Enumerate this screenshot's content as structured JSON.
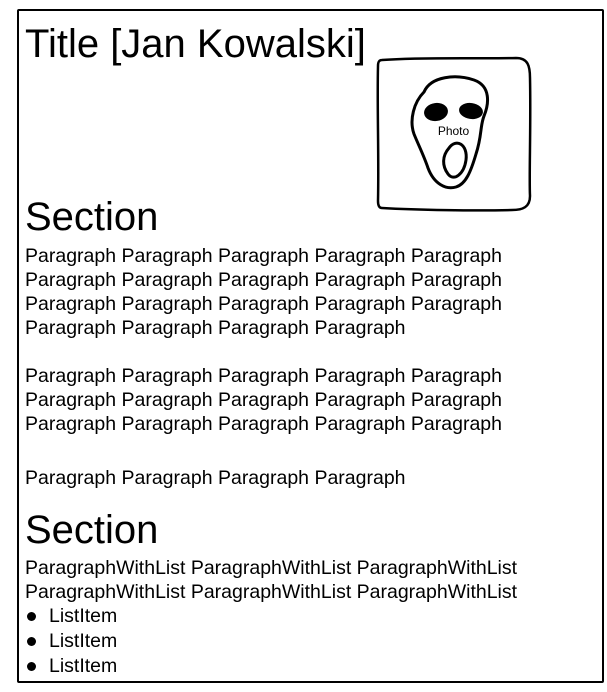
{
  "title": "Title [Jan Kowalski]",
  "photo": {
    "label": "Photo",
    "icon": "scream-face-icon"
  },
  "sections": [
    {
      "heading": "Section",
      "paragraphs": [
        "Paragraph Paragraph Paragraph Paragraph Paragraph Paragraph Paragraph Paragraph Paragraph Paragraph Paragraph Paragraph Paragraph Paragraph Paragraph Paragraph Paragraph Paragraph Paragraph",
        "Paragraph Paragraph Paragraph Paragraph Paragraph Paragraph Paragraph Paragraph Paragraph Paragraph Paragraph Paragraph Paragraph Paragraph Paragraph",
        "Paragraph Paragraph Paragraph Paragraph"
      ]
    },
    {
      "heading": "Section",
      "paragraphs": [
        "ParagraphWithList ParagraphWithList ParagraphWithList ParagraphWithList ParagraphWithList ParagraphWithList"
      ],
      "list": [
        "ListItem",
        "ListItem",
        "ListItem"
      ]
    }
  ]
}
